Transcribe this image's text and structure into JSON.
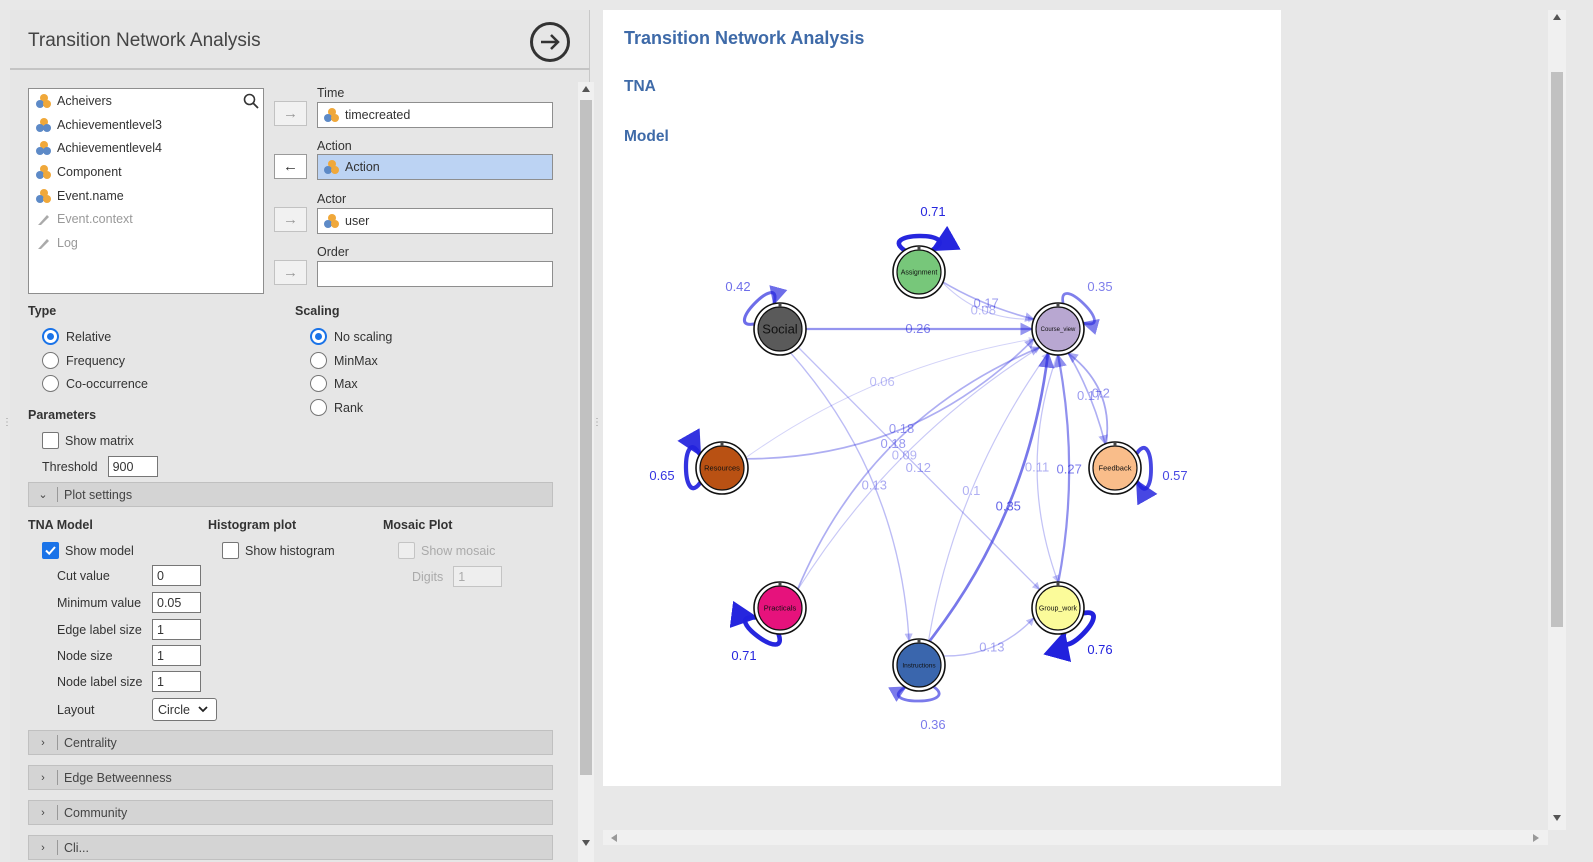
{
  "panel": {
    "title": "Transition Network Analysis"
  },
  "variables": [
    {
      "name": "Acheivers",
      "type": "nominal",
      "enabled": true
    },
    {
      "name": "Achievementlevel3",
      "type": "ordinal",
      "enabled": true
    },
    {
      "name": "Achievementlevel4",
      "type": "ordinal",
      "enabled": true
    },
    {
      "name": "Component",
      "type": "nominal",
      "enabled": true
    },
    {
      "name": "Event.name",
      "type": "nominal",
      "enabled": true
    },
    {
      "name": "Event.context",
      "type": "text",
      "enabled": false
    },
    {
      "name": "Log",
      "type": "text",
      "enabled": false
    }
  ],
  "targets": {
    "time": {
      "label": "Time",
      "value": "timecreated"
    },
    "action": {
      "label": "Action",
      "value": "Action"
    },
    "actor": {
      "label": "Actor",
      "value": "user"
    },
    "order": {
      "label": "Order",
      "value": ""
    }
  },
  "type": {
    "label": "Type",
    "options": [
      "Relative",
      "Frequency",
      "Co-occurrence"
    ],
    "selected": "Relative"
  },
  "scaling": {
    "label": "Scaling",
    "options": [
      "No scaling",
      "MinMax",
      "Max",
      "Rank"
    ],
    "selected": "No scaling"
  },
  "parameters": {
    "label": "Parameters",
    "show_matrix": "Show matrix",
    "threshold_label": "Threshold",
    "threshold": "900"
  },
  "plot_settings": {
    "label": "Plot settings",
    "tna_model": "TNA Model",
    "show_model": "Show model",
    "cut_label": "Cut value",
    "cut": "0",
    "min_label": "Minimum value",
    "min": "0.05",
    "els_label": "Edge label size",
    "els": "1",
    "ns_label": "Node size",
    "ns": "1",
    "nls_label": "Node label size",
    "nls": "1",
    "layout_label": "Layout",
    "layout": "Circle",
    "histogram": "Histogram plot",
    "show_histogram": "Show histogram",
    "mosaic": "Mosaic Plot",
    "show_mosaic": "Show mosaic",
    "digits_label": "Digits",
    "digits": "1"
  },
  "sections": {
    "centrality": "Centrality",
    "edge_betweenness": "Edge Betweenness",
    "community": "Community",
    "cliques": "Cli..."
  },
  "results": {
    "title": "Transition Network Analysis",
    "sub": "TNA",
    "model": "Model"
  },
  "colors": {
    "accent": "#1a73e8",
    "heading": "#3e6aa8",
    "edge": "#2222dd"
  },
  "network": {
    "nodes": [
      {
        "id": "Assignment",
        "color": "#77c77a",
        "label_size": 7
      },
      {
        "id": "Course_view",
        "color": "#b8a7d1",
        "label_size": 6
      },
      {
        "id": "Feedback",
        "color": "#f9bd8a",
        "label_size": 7.5
      },
      {
        "id": "Group_work",
        "color": "#fbfb9a",
        "label_size": 7
      },
      {
        "id": "Instructions",
        "color": "#3a66ad",
        "label_size": 6.5
      },
      {
        "id": "Practicals",
        "color": "#e6127c",
        "label_size": 7.5
      },
      {
        "id": "Resources",
        "color": "#b95113",
        "label_size": 7.5
      },
      {
        "id": "Social",
        "color": "#5a5a5a",
        "label_size": 13
      }
    ],
    "self_loops": [
      {
        "node": "Assignment",
        "value": "0.71"
      },
      {
        "node": "Course_view",
        "value": "0.35"
      },
      {
        "node": "Feedback",
        "value": "0.57"
      },
      {
        "node": "Group_work",
        "value": "0.76"
      },
      {
        "node": "Instructions",
        "value": "0.36"
      },
      {
        "node": "Practicals",
        "value": "0.71"
      },
      {
        "node": "Resources",
        "value": "0.65"
      },
      {
        "node": "Social",
        "value": "0.42"
      }
    ],
    "edges": [
      {
        "from": "Social",
        "to": "Course_view",
        "value": "0.26"
      },
      {
        "from": "Assignment",
        "to": "Course_view",
        "value": "0.17"
      },
      {
        "from": "Assignment",
        "to": "Course_view",
        "value": "0.08"
      },
      {
        "from": "Resources",
        "to": "Course_view",
        "value": "0.18"
      },
      {
        "from": "Practicals",
        "to": "Course_view",
        "value": "0.18"
      },
      {
        "from": "Instructions",
        "to": "Course_view",
        "value": "0.35"
      },
      {
        "from": "Group_work",
        "to": "Course_view",
        "value": "0.27"
      },
      {
        "from": "Feedback",
        "to": "Course_view",
        "value": "0.2"
      },
      {
        "from": "Course_view",
        "to": "Feedback",
        "value": "0.17"
      },
      {
        "from": "Course_view",
        "to": "Group_work",
        "value": "0.11"
      },
      {
        "from": "Social",
        "to": "Instructions",
        "value": "0.13"
      },
      {
        "from": "Social",
        "to": "Group_work",
        "value": "0.12"
      },
      {
        "from": "Resources",
        "to": "Course_view",
        "value": "0.06"
      },
      {
        "from": "Practicals",
        "to": "Course_view",
        "value": "0.09"
      },
      {
        "from": "Instructions",
        "to": "Course_view",
        "value": "0.1"
      },
      {
        "from": "Instructions",
        "to": "Group_work",
        "value": "0.13"
      }
    ]
  }
}
